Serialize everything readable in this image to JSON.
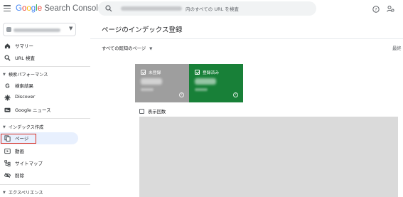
{
  "header": {
    "logo_g": "G",
    "logo_o1": "o",
    "logo_o2": "o",
    "logo_g2": "g",
    "logo_l": "l",
    "logo_e": "e",
    "logo_rest": " Search Console",
    "search_suffix": "内のすべての URL を検査",
    "icons": [
      "menu-icon",
      "search-icon",
      "help-icon",
      "manage-users-icon"
    ]
  },
  "sidebar": {
    "items": [
      {
        "label": "サマリー",
        "icon": "home-icon"
      },
      {
        "label": "URL 検査",
        "icon": "search-icon"
      }
    ],
    "section_performance": "検索パフォーマンス",
    "performance_items": [
      {
        "label": "検索結果",
        "icon": "google-g-icon"
      },
      {
        "label": "Discover",
        "icon": "asterisk-icon"
      },
      {
        "label": "Google ニュース",
        "icon": "news-icon"
      }
    ],
    "section_indexing": "インデックス作成",
    "indexing_items": [
      {
        "label": "ページ",
        "icon": "pages-icon",
        "active": true
      },
      {
        "label": "動画",
        "icon": "video-icon"
      },
      {
        "label": "サイトマップ",
        "icon": "sitemap-icon"
      },
      {
        "label": "削除",
        "icon": "removal-icon"
      }
    ],
    "section_experience": "エクスペリエンス"
  },
  "main": {
    "title": "ページのインデックス登録",
    "filter_label": "すべての既知のページ",
    "last_updated_label": "最終",
    "cards": [
      {
        "label": "未登録",
        "color": "#9e9e9e"
      },
      {
        "label": "登録済み",
        "color": "#188038"
      }
    ],
    "impressions_label": "表示回数"
  },
  "colors": {
    "accent": "#1a73e8",
    "active_bg": "#e8f0fe",
    "highlight_border": "#d93025",
    "indexed": "#188038",
    "not_indexed": "#9e9e9e"
  }
}
